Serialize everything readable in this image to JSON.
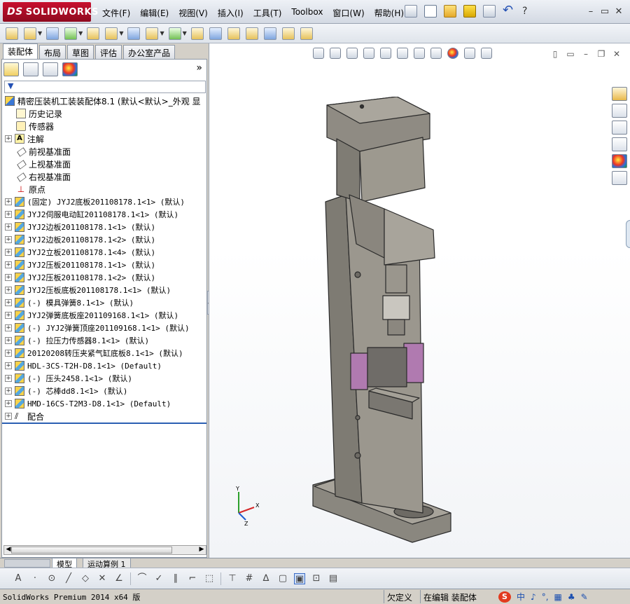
{
  "app": {
    "brand_ds": "DS",
    "brand_name": "SOLIDWORKS"
  },
  "menu": [
    "文件(F)",
    "编辑(E)",
    "视图(V)",
    "插入(I)",
    "工具(T)",
    "Toolbox",
    "窗口(W)",
    "帮助(H)"
  ],
  "title_help": "?",
  "window_buttons": [
    "–",
    "▭",
    "✕"
  ],
  "tabs": [
    {
      "label": "装配体",
      "active": true
    },
    {
      "label": "布局",
      "active": false
    },
    {
      "label": "草图",
      "active": false
    },
    {
      "label": "评估",
      "active": false
    },
    {
      "label": "办公室产品",
      "active": false
    }
  ],
  "panel": {
    "expand_glyph": "»",
    "filter_glyph": "▼"
  },
  "tree": {
    "root": "精密压装机工装装配体8.1  (默认<默认>_外观 显",
    "items": [
      {
        "icon": "history-icon",
        "label": "历史记录",
        "expandable": false
      },
      {
        "icon": "sensor-icon",
        "label": "传感器",
        "expandable": false
      },
      {
        "icon": "annotation-icon",
        "label": "注解",
        "expandable": true
      },
      {
        "icon": "plane-icon",
        "label": "前视基准面",
        "expandable": false
      },
      {
        "icon": "plane-icon",
        "label": "上视基准面",
        "expandable": false
      },
      {
        "icon": "plane-icon",
        "label": "右视基准面",
        "expandable": false
      },
      {
        "icon": "origin-icon",
        "label": "原点",
        "expandable": false
      }
    ],
    "components": [
      "(固定) JYJ2底板201108178.1<1> (默认)",
      "JYJ2伺服电动缸201108178.1<1> (默认)",
      "JYJ2边板201108178.1<1> (默认)",
      "JYJ2边板201108178.1<2> (默认)",
      "JYJ2立板201108178.1<4> (默认)",
      "JYJ2压板201108178.1<1> (默认)",
      "JYJ2压板201108178.1<2> (默认)",
      "JYJ2压板底板201108178.1<1> (默认)",
      "(-) 模具弹簧8.1<1> (默认)",
      "JYJ2弹簧底板座201109168.1<1> (默认)",
      "(-) JYJ2弹簧顶座201109168.1<1> (默认)",
      "(-) 拉压力传感器8.1<1> (默认)",
      "20120208转压夹紧气缸底板8.1<1> (默认)",
      "HDL-3CS-T2H-D8.1<1> (Default)",
      "(-) 压头2458.1<1> (默认)",
      "(-) 芯棒dd8.1<1> (默认)",
      "HMD-16CS-T2M3-D8.1<1> (Default)"
    ],
    "mates": "配合"
  },
  "bottom_tabs": [
    {
      "label": "模型",
      "active": true
    },
    {
      "label": "运动算例 1",
      "active": false
    }
  ],
  "status": {
    "app": "SolidWorks Premium 2014 x64 版",
    "state": "欠定义",
    "mode": "在编辑 装配体",
    "tray": [
      "中",
      "♪",
      "°,",
      "▦",
      "♣",
      "✎"
    ]
  },
  "colors": {
    "brand": "#c8102e",
    "model_gray": "#8c8880",
    "clamp_purple": "#b07ab0",
    "selection_blue": "#2b5fb3"
  }
}
